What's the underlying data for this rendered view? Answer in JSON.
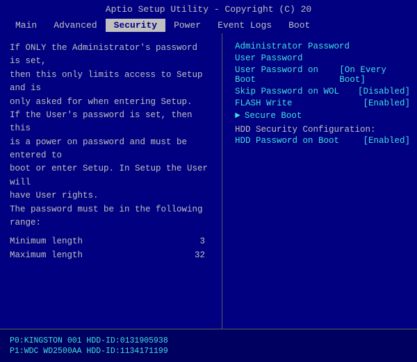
{
  "titleBar": {
    "text": "Aptio Setup Utility - Copyright (C) 20"
  },
  "nav": {
    "items": [
      {
        "label": "Main",
        "active": false
      },
      {
        "label": "Advanced",
        "active": false
      },
      {
        "label": "Security",
        "active": true
      },
      {
        "label": "Power",
        "active": false
      },
      {
        "label": "Event Logs",
        "active": false
      },
      {
        "label": "Boot",
        "active": false
      }
    ]
  },
  "description": {
    "lines": [
      "If ONLY the Administrator's password is set,",
      "then this only limits access to Setup and is",
      "only asked for when entering Setup.",
      "If the User's password is set, then this",
      "is a power on password and must be entered to",
      "boot or enter Setup. In Setup the User will",
      "have User rights.",
      "The password must be in the following range:"
    ],
    "minLengthLabel": "Minimum length",
    "minLengthValue": "3",
    "maxLengthLabel": "Maximum length",
    "maxLengthValue": "32"
  },
  "menu": {
    "items": [
      {
        "label": "Administrator Password",
        "value": ""
      },
      {
        "label": "User Password",
        "value": ""
      },
      {
        "label": "User Password on Boot",
        "value": "[On Every Boot]"
      },
      {
        "label": "Skip Password on WOL",
        "value": "[Disabled]"
      },
      {
        "label": "FLASH Write",
        "value": "[Enabled]"
      }
    ],
    "secureBoot": {
      "label": "Secure Boot"
    },
    "hddSection": {
      "title": "HDD Security Configuration:",
      "items": [
        {
          "label": "HDD Password on Boot",
          "value": "[Enabled]"
        }
      ]
    }
  },
  "drives": [
    {
      "text": "P0:KINGSTON  001  HDD-ID:0131905938"
    },
    {
      "text": "P1:WDC WD2500AA  HDD-ID:1134171199"
    }
  ]
}
